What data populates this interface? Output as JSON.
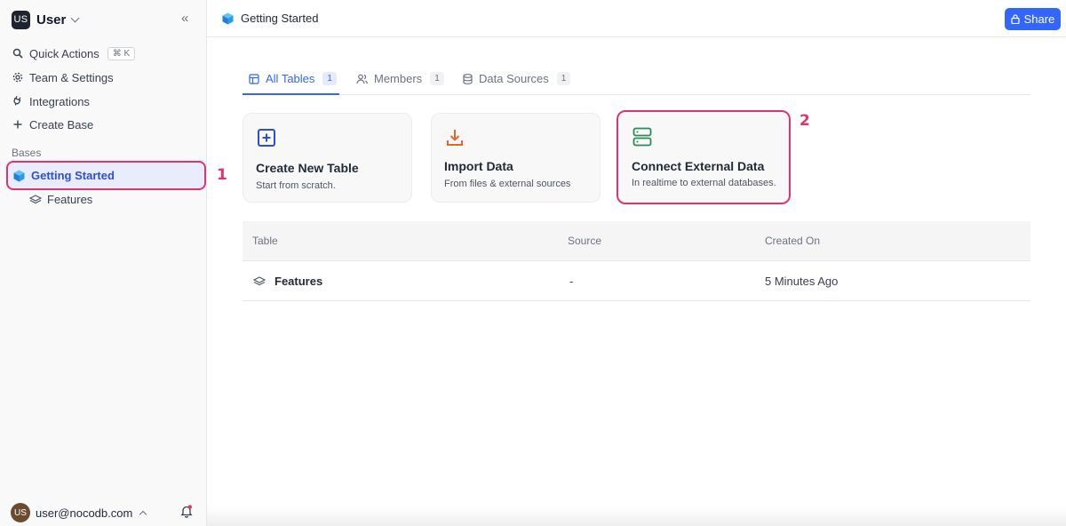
{
  "workspace": {
    "avatar_initials": "US",
    "name": "User",
    "collapse_icon": "double-chevron-left-icon"
  },
  "sidebar": {
    "quick_actions": {
      "label": "Quick Actions",
      "shortcut": "⌘ K",
      "icon": "search-icon"
    },
    "items": [
      {
        "label": "Team & Settings",
        "icon": "gear-icon"
      },
      {
        "label": "Integrations",
        "icon": "plug-icon"
      },
      {
        "label": "Create Base",
        "icon": "plus-icon"
      }
    ],
    "section_label": "Bases",
    "active_base": {
      "label": "Getting Started",
      "icon": "cube-icon",
      "annotation": "1"
    },
    "tables": [
      {
        "label": "Features",
        "icon": "layers-icon"
      }
    ]
  },
  "user": {
    "avatar_initials": "US",
    "email": "user@nocodb.com",
    "notification_icon": "bell-icon"
  },
  "topbar": {
    "breadcrumb": "Getting Started",
    "share_label": "Share"
  },
  "tabs": [
    {
      "label": "All Tables",
      "count": "1",
      "active": true,
      "icon": "table-icon"
    },
    {
      "label": "Members",
      "count": "1",
      "active": false,
      "icon": "users-icon"
    },
    {
      "label": "Data Sources",
      "count": "1",
      "active": false,
      "icon": "database-icon"
    }
  ],
  "cards": [
    {
      "title": "Create New Table",
      "subtitle": "Start from scratch.",
      "icon": "plus-square-icon",
      "color": "#2f4fd1"
    },
    {
      "title": "Import Data",
      "subtitle": "From files & external sources",
      "icon": "download-icon",
      "color": "#e06a2c"
    },
    {
      "title": "Connect External Data",
      "subtitle": "In realtime to external databases.",
      "icon": "server-icon",
      "color": "#2e8b57",
      "annotation": "2"
    }
  ],
  "table": {
    "columns": [
      "Table",
      "Source",
      "Created On"
    ],
    "rows": [
      {
        "name": "Features",
        "source": "-",
        "created": "5 Minutes Ago"
      }
    ]
  },
  "colors": {
    "accent": "#3366ff",
    "highlight": "#e0356b"
  }
}
